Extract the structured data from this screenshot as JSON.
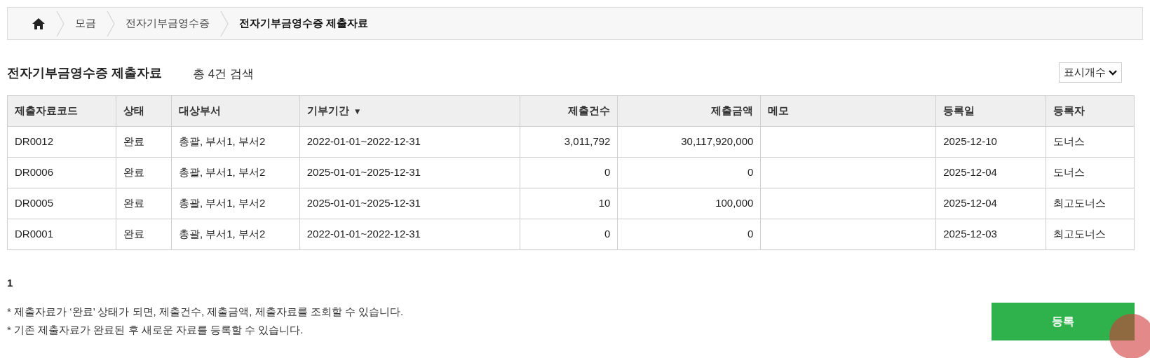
{
  "breadcrumb": [
    {
      "label": "모금",
      "current": false
    },
    {
      "label": "전자기부금영수증",
      "current": false
    },
    {
      "label": "전자기부금영수증 제출자료",
      "current": true
    }
  ],
  "heading": {
    "title": "전자기부금영수증 제출자료",
    "count": "총 4건 검색"
  },
  "page_size_select": {
    "value": "표시개수"
  },
  "table": {
    "columns": [
      {
        "label": "제출자료코드",
        "kind": "text"
      },
      {
        "label": "상태",
        "kind": "text"
      },
      {
        "label": "대상부서",
        "kind": "text"
      },
      {
        "label": "기부기간",
        "kind": "text",
        "sort": "▼"
      },
      {
        "label": "제출건수",
        "kind": "number"
      },
      {
        "label": "제출금액",
        "kind": "number"
      },
      {
        "label": "메모",
        "kind": "text"
      },
      {
        "label": "등록일",
        "kind": "text"
      },
      {
        "label": "등록자",
        "kind": "text"
      }
    ],
    "rows": [
      [
        "DR0012",
        "완료",
        "총괄, 부서1, 부서2",
        "2022-01-01~2022-12-31",
        "3,011,792",
        "30,117,920,000",
        "",
        "2025-12-10",
        "도너스"
      ],
      [
        "DR0006",
        "완료",
        "총괄, 부서1, 부서2",
        "2025-01-01~2025-12-31",
        "0",
        "0",
        "",
        "2025-12-04",
        "도너스"
      ],
      [
        "DR0005",
        "완료",
        "총괄, 부서1, 부서2",
        "2025-01-01~2025-12-31",
        "10",
        "100,000",
        "",
        "2025-12-04",
        "최고도너스"
      ],
      [
        "DR0001",
        "완료",
        "총괄, 부서1, 부서2",
        "2022-01-01~2022-12-31",
        "0",
        "0",
        "",
        "2025-12-03",
        "최고도너스"
      ]
    ]
  },
  "pagination": [
    {
      "label": "1",
      "selected": true
    }
  ],
  "notes": [
    "* 제출자료가 ‘완료’ 상태가 되면, 제출건수, 제출금액, 제출자료를 조회할 수 있습니다.",
    "* 기존 제출자료가 완료된 후 새로운 자료를 등록할 수 있습니다."
  ],
  "register_button": {
    "label": "등록"
  }
}
